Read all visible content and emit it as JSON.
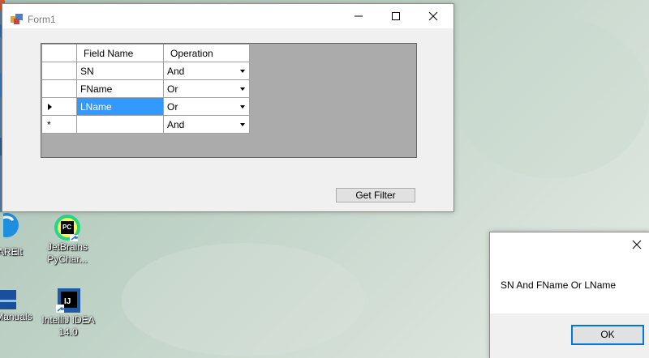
{
  "window": {
    "title": "Form1",
    "grid": {
      "columns": [
        "Field Name",
        "Operation"
      ],
      "rows": [
        {
          "indicator": "",
          "field_name": "SN",
          "operation": "And"
        },
        {
          "indicator": "",
          "field_name": "FName",
          "operation": "Or"
        },
        {
          "indicator": "current-row-arrow",
          "field_name": "LName",
          "operation": "Or"
        },
        {
          "indicator": "*",
          "field_name": "",
          "operation": "And"
        }
      ]
    },
    "get_filter_label": "Get Filter"
  },
  "desktop": {
    "icons": [
      {
        "label": "ARElt",
        "icon": "arelt-app-icon"
      },
      {
        "label": "JetBrains PyChar...",
        "line1": "JetBrains",
        "line2": "PyChar...",
        "icon": "pycharm-icon"
      },
      {
        "label": "Manuals",
        "icon": "manuals-icon"
      },
      {
        "label": "IntelliJ IDEA 14.0",
        "line1": "IntelliJ IDEA",
        "line2": "14.0",
        "icon": "intellij-icon"
      }
    ]
  },
  "message_box": {
    "text": "SN And FName Or LName",
    "ok_label": "OK"
  },
  "colors": {
    "selection": "#3399ff",
    "grid_background": "#ababab",
    "default_button_border": "#0078d7"
  }
}
